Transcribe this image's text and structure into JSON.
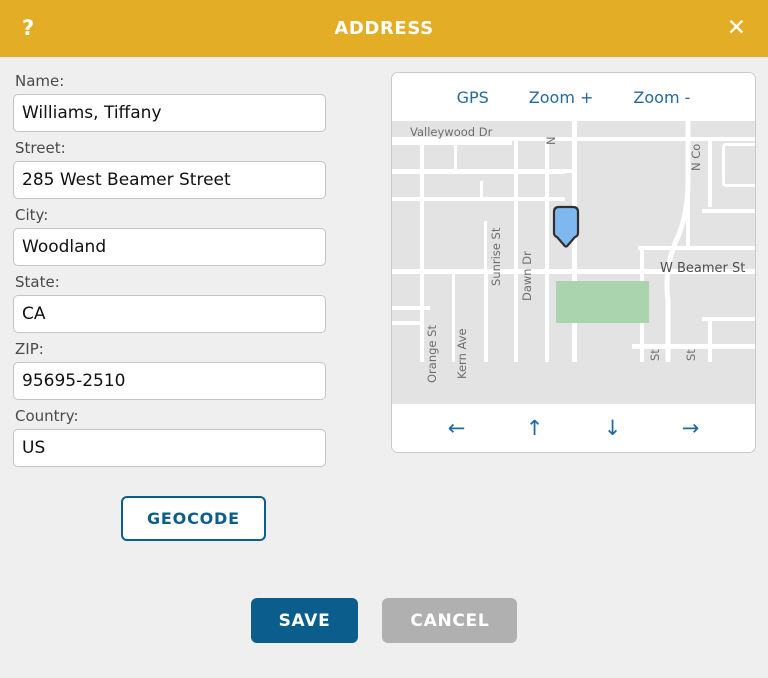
{
  "titlebar": {
    "help_label": "?",
    "title": "ADDRESS",
    "close_label": "✕"
  },
  "form": {
    "fields": [
      {
        "label": "Name:",
        "value": "Williams, Tiffany",
        "name": "name"
      },
      {
        "label": "Street:",
        "value": "285 West Beamer Street",
        "name": "street"
      },
      {
        "label": "City:",
        "value": "Woodland",
        "name": "city"
      },
      {
        "label": "State:",
        "value": "CA",
        "name": "state"
      },
      {
        "label": "ZIP:",
        "value": "95695-2510",
        "name": "zip"
      },
      {
        "label": "Country:",
        "value": "US",
        "name": "country"
      }
    ],
    "geocode_label": "GEOCODE"
  },
  "map": {
    "toolbar": [
      {
        "label": "GPS",
        "name": "gps"
      },
      {
        "label": "Zoom +",
        "name": "zoom-in"
      },
      {
        "label": "Zoom -",
        "name": "zoom-out"
      }
    ],
    "nav": [
      {
        "label": "←",
        "name": "pan-left"
      },
      {
        "label": "↑",
        "name": "pan-up"
      },
      {
        "label": "↓",
        "name": "pan-down"
      },
      {
        "label": "→",
        "name": "pan-right"
      }
    ],
    "labels": [
      "Valleywood Dr",
      "N",
      "Sunrise St",
      "Dawn Dr",
      "N Co",
      "W Beamer St",
      "Orange St",
      "Kern Ave",
      "St",
      "St"
    ],
    "pin_color": "#7fb8ee"
  },
  "footer": {
    "save_label": "SAVE",
    "cancel_label": "CANCEL"
  },
  "colors": {
    "header": "#e3ae26",
    "accent_blue": "#0b5e8c",
    "cancel_gray": "#b0b0b0",
    "background": "#efefef",
    "map_bg": "#e3e3e3",
    "park_green": "#a9d4ae"
  }
}
